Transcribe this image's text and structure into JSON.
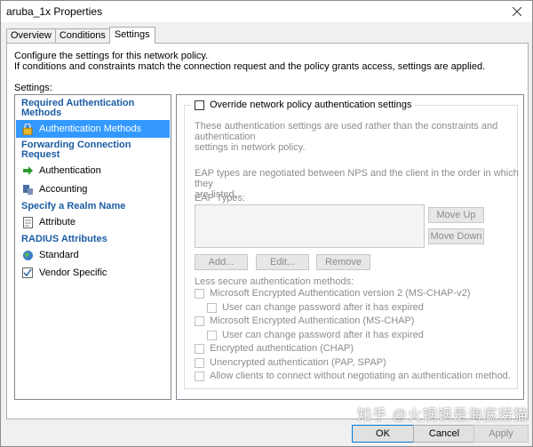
{
  "window": {
    "title": "aruba_1x Properties"
  },
  "tabs": [
    {
      "label": "Overview"
    },
    {
      "label": "Conditions"
    },
    {
      "label": "Settings"
    }
  ],
  "intro": {
    "line1": "Configure the settings for this network policy.",
    "line2": "If conditions and constraints match the connection request and the policy grants access, settings are applied."
  },
  "settings_label": "Settings:",
  "sidebar": {
    "headers": [
      "Required Authentication Methods",
      "Forwarding Connection Request",
      "Specify a Realm Name",
      "RADIUS Attributes"
    ],
    "items": [
      {
        "label": "Authentication Methods",
        "icon": "lock-icon"
      },
      {
        "label": "Authentication",
        "icon": "arrow-right-icon"
      },
      {
        "label": "Accounting",
        "icon": "server-icon"
      },
      {
        "label": "Attribute",
        "icon": "document-icon"
      },
      {
        "label": "Standard",
        "icon": "globe-icon"
      },
      {
        "label": "Vendor Specific",
        "icon": "checklist-icon"
      }
    ]
  },
  "main": {
    "override_label": "Override network policy authentication settings",
    "desc1_line1": "These authentication settings are used rather than the constraints and authentication",
    "desc1_line2": "settings in network policy.",
    "desc2_line1": "EAP types are negotiated between NPS and the client in the order in which they",
    "desc2_line2": "are listed.",
    "eap_types_label": "EAP Types:",
    "buttons": {
      "move_up": "Move Up",
      "move_down": "Move Down",
      "add": "Add...",
      "edit": "Edit...",
      "remove": "Remove"
    },
    "less_secure_label": "Less secure authentication methods:",
    "checkboxes": [
      "Microsoft Encrypted Authentication version 2 (MS-CHAP-v2)",
      "User can change password after it has expired",
      "Microsoft Encrypted Authentication (MS-CHAP)",
      "User can change password after it has expired",
      "Encrypted authentication (CHAP)",
      "Unencrypted authentication (PAP, SPAP)",
      "Allow clients to connect without negotiating an authentication method."
    ]
  },
  "footer": {
    "ok": "OK",
    "cancel": "Cancel",
    "apply": "Apply"
  },
  "watermark": "知乎 @火锅锅是海底捞猫"
}
